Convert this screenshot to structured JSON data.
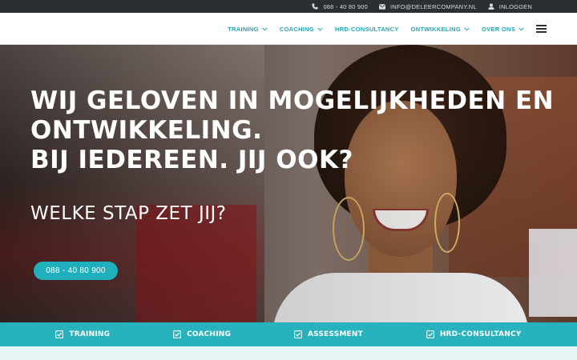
{
  "topbar": {
    "phone": "088 - 40 80 900",
    "email": "INFO@DELEERCOMPANY.NL",
    "login": "INLOGGEN"
  },
  "nav": {
    "items": [
      {
        "label": "TRAINING",
        "dropdown": true
      },
      {
        "label": "COACHING",
        "dropdown": true
      },
      {
        "label": "HRD-CONSULTANCY",
        "dropdown": false
      },
      {
        "label": "ONTWIKKELING",
        "dropdown": true
      },
      {
        "label": "OVER ONS",
        "dropdown": true
      }
    ]
  },
  "hero": {
    "headline_lines": [
      "WIJ GELOVEN IN MOGELIJKHEDEN EN",
      "ONTWIKKELING.",
      "BIJ IEDEREEN. JIJ OOK?"
    ],
    "subheadline": "WELKE STAP ZET JIJ?",
    "cta_phone": "088 - 40 80 900"
  },
  "bottombar": {
    "items": [
      "TRAINING",
      "COACHING",
      "ASSESSMENT",
      "HRD-CONSULTANCY"
    ]
  },
  "colors": {
    "accent": "#1fa7b3",
    "topbar_bg": "#2b2e33",
    "bottombar_bg": "#27b2bd"
  }
}
